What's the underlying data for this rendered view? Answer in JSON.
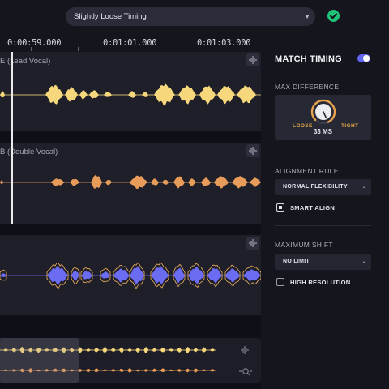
{
  "header": {
    "preset_label": "Slightly Loose Timing",
    "status_icon": "check-circle-icon"
  },
  "timeline": {
    "ticks": [
      "0:00:59.000",
      "0:01:01.000",
      "0:01:03.000"
    ]
  },
  "tracks": [
    {
      "label": "E (Lead Vocal)",
      "color": "#f7d77c"
    },
    {
      "label": "B (Double Vocal)",
      "color": "#e89c5a"
    },
    {
      "label": "",
      "color": "#6c6cf2",
      "outline_color": "#e0a65a"
    }
  ],
  "panel": {
    "title": "MATCH TIMING",
    "match_timing_enabled": true,
    "max_difference": {
      "label": "MAX DIFFERENCE",
      "left_label": "LOOSE",
      "right_label": "TIGHT",
      "value": "33 MS"
    },
    "alignment_rule": {
      "label": "ALIGNMENT RULE",
      "selected": "NORMAL FLEXIBILITY"
    },
    "smart_align": {
      "label": "SMART ALIGN",
      "checked": true
    },
    "maximum_shift": {
      "label": "MAXIMUM SHIFT",
      "selected": "NO LIMIT"
    },
    "high_resolution": {
      "label": "HIGH RESOLUTION",
      "checked": false
    }
  },
  "colors": {
    "accent": "#6366f0",
    "lead": "#f7d77c",
    "double": "#e89c5a",
    "aligned": "#6c6cf2",
    "knob_ring": "#e8a44c",
    "status_ok": "#20c278"
  }
}
